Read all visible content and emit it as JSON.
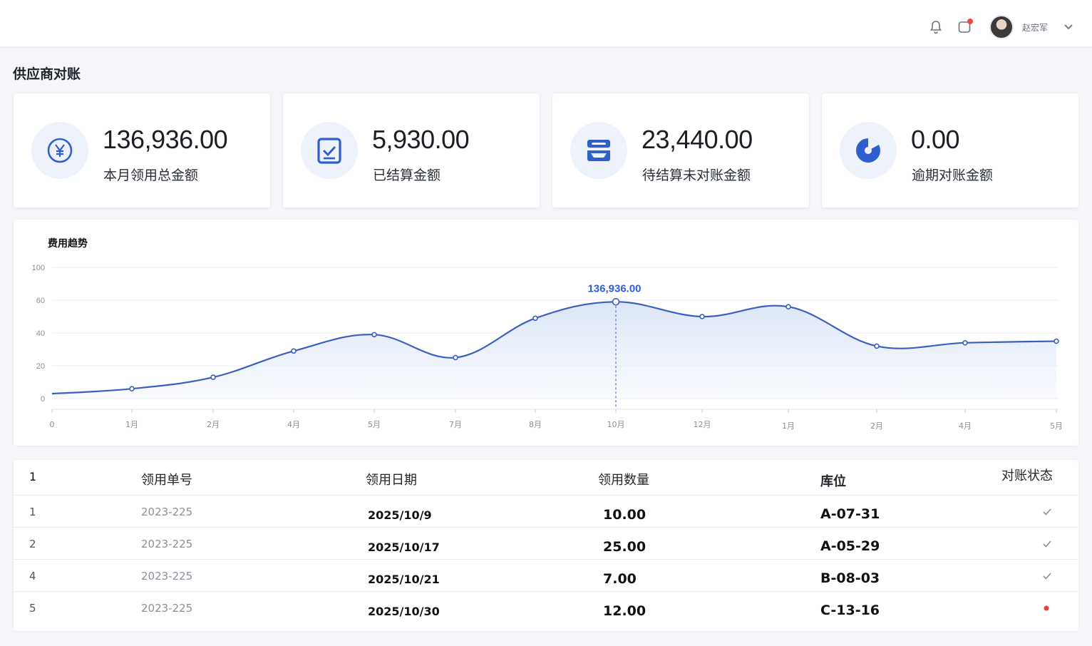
{
  "header": {
    "user_name": "赵宏军",
    "icons": [
      "bell-icon",
      "notification-icon",
      "chevron-down-icon"
    ],
    "notification_badge_color": "#f04848"
  },
  "page": {
    "title": "供应商对账"
  },
  "stats": [
    {
      "value": "136,936.00",
      "label": "本月领用总金额",
      "icon": "yen-icon"
    },
    {
      "value": "5,930.00",
      "label": "已结算金额",
      "icon": "checklist-icon"
    },
    {
      "value": "23,440.00",
      "label": "待结算未对账金额",
      "icon": "inbox-stack-icon"
    },
    {
      "value": "0.00",
      "label": "逾期对账金额",
      "icon": "pie-progress-icon"
    }
  ],
  "colors": {
    "accent": "#2f5fcf",
    "line": "#3a5fc0",
    "area": "#dbe5f7"
  },
  "chart": {
    "title": "费用趋势",
    "highlight_label": "136,936.00"
  },
  "chart_data": {
    "type": "area",
    "title": "费用趋势",
    "x": [
      "0",
      "1月",
      "2月",
      "4月",
      "5月",
      "7月",
      "8月",
      "10月",
      "12月",
      "1月",
      "2月",
      "4月",
      "5月"
    ],
    "series": [
      {
        "values": [
          3,
          6,
          13,
          29,
          39,
          25,
          49,
          59,
          50,
          56,
          32,
          34,
          35
        ]
      }
    ],
    "yticks": [
      0,
      20,
      40,
      60,
      100
    ],
    "ylim": [
      0,
      100
    ],
    "grid": true,
    "highlight_index": 7
  },
  "table": {
    "columns": [
      "1",
      "领用单号",
      "领用日期",
      "领用数量",
      "库位",
      "对账状态"
    ],
    "rows": [
      {
        "idx": "1",
        "no": "2023-225",
        "date": "2025/10/9",
        "qty": "10.00",
        "loc": "A-07-31",
        "status": "check"
      },
      {
        "idx": "2",
        "no": "2023-225",
        "date": "2025/10/17",
        "qty": "25.00",
        "loc": "A-05-29",
        "status": "check"
      },
      {
        "idx": "4",
        "no": "2023-225",
        "date": "2025/10/21",
        "qty": "7.00",
        "loc": "B-08-03",
        "status": "check"
      },
      {
        "idx": "5",
        "no": "2023-225",
        "date": "2025/10/30",
        "qty": "12.00",
        "loc": "C-13-16",
        "status": "dot"
      }
    ]
  }
}
